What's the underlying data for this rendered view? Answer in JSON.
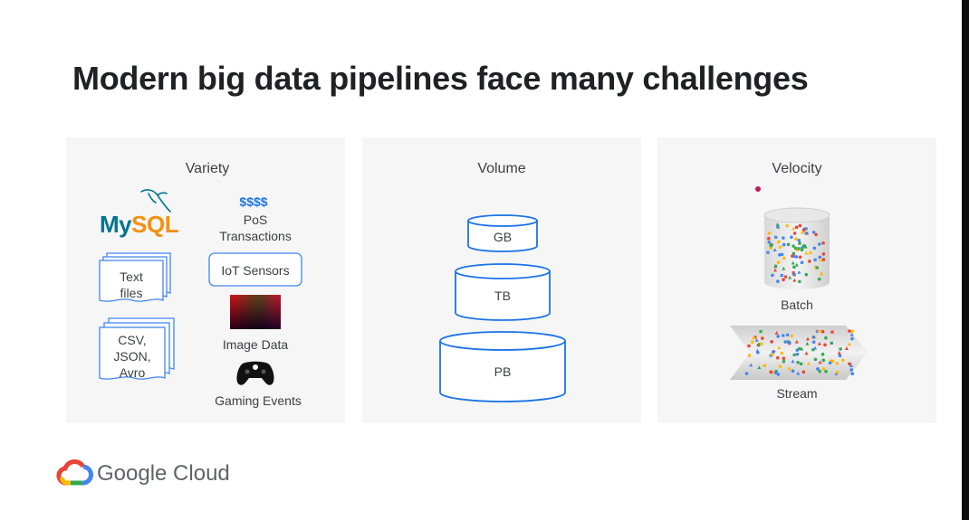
{
  "slide": {
    "title": "Modern big data pipelines face many challenges",
    "brand": "Google Cloud"
  },
  "variety": {
    "heading": "Variety",
    "mysql_logo_text": "MySQL",
    "dollar_symbols": "$$$$",
    "pos_line1": "PoS",
    "pos_line2": "Transactions",
    "iot": "IoT Sensors",
    "text_files_line1": "Text",
    "text_files_line2": "files",
    "csv_line1": "CSV,",
    "csv_line2": "JSON,",
    "csv_line3": "Avro",
    "image_data": "Image Data",
    "gaming": "Gaming Events"
  },
  "volume": {
    "heading": "Volume",
    "tiers": [
      "GB",
      "TB",
      "PB"
    ]
  },
  "velocity": {
    "heading": "Velocity",
    "batch": "Batch",
    "stream": "Stream"
  },
  "colors": {
    "accent_blue": "#4285f4",
    "accent_red": "#ea4335",
    "accent_yellow": "#fbbc04",
    "accent_green": "#34a853",
    "outline_blue": "#1a73e8",
    "mysql_teal": "#00758f",
    "mysql_orange": "#f29111"
  }
}
